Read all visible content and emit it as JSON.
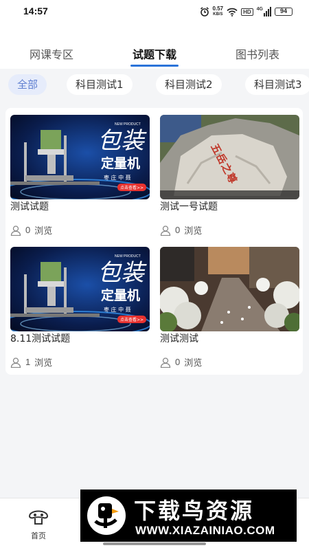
{
  "status_bar": {
    "time": "14:57",
    "net_speed_value": "0.57",
    "net_speed_unit": "KB/S",
    "hd_label": "HD",
    "network_label": "4G",
    "battery": "94"
  },
  "tabs": [
    {
      "label": "网课专区",
      "active": false
    },
    {
      "label": "试题下载",
      "active": true
    },
    {
      "label": "图书列表",
      "active": false
    }
  ],
  "filters": [
    {
      "label": "全部",
      "active": true
    },
    {
      "label": "科目测试1",
      "active": false
    },
    {
      "label": "科目测试2",
      "active": false
    },
    {
      "label": "科目测试3",
      "active": false
    }
  ],
  "cards": [
    {
      "title": "测试试题",
      "views": "0",
      "views_unit": "浏览",
      "image": "packaging-machine",
      "image_text": {
        "tag": "NEW PRODUCT",
        "big": "包装",
        "sub": "定量机",
        "small": "枣 庄 中 聂",
        "btn": "点击查看>>"
      }
    },
    {
      "title": "测试一号试题",
      "views": "0",
      "views_unit": "浏览",
      "image": "carved-rock",
      "image_text": {
        "carving": "五岳之尊"
      }
    },
    {
      "title": "8.11测试试题",
      "views": "1",
      "views_unit": "浏览",
      "image": "packaging-machine",
      "image_text": {
        "tag": "NEW PRODUCT",
        "big": "包装",
        "sub": "定量机",
        "small": "枣 庄 中 聂",
        "btn": "点击查看>>"
      }
    },
    {
      "title": "测试测试",
      "views": "0",
      "views_unit": "浏览",
      "image": "flower-aisle",
      "image_text": {}
    }
  ],
  "bottom_nav": {
    "home_label": "首页"
  },
  "watermark": {
    "title": "下载鸟资源",
    "url": "WWW.XIAZAINIAO.COM"
  },
  "colors": {
    "accent": "#2a73d9",
    "chip_active_bg": "#e6ecfb",
    "chip_active_text": "#5f7fd0",
    "page_bg": "#f4f5f7"
  }
}
